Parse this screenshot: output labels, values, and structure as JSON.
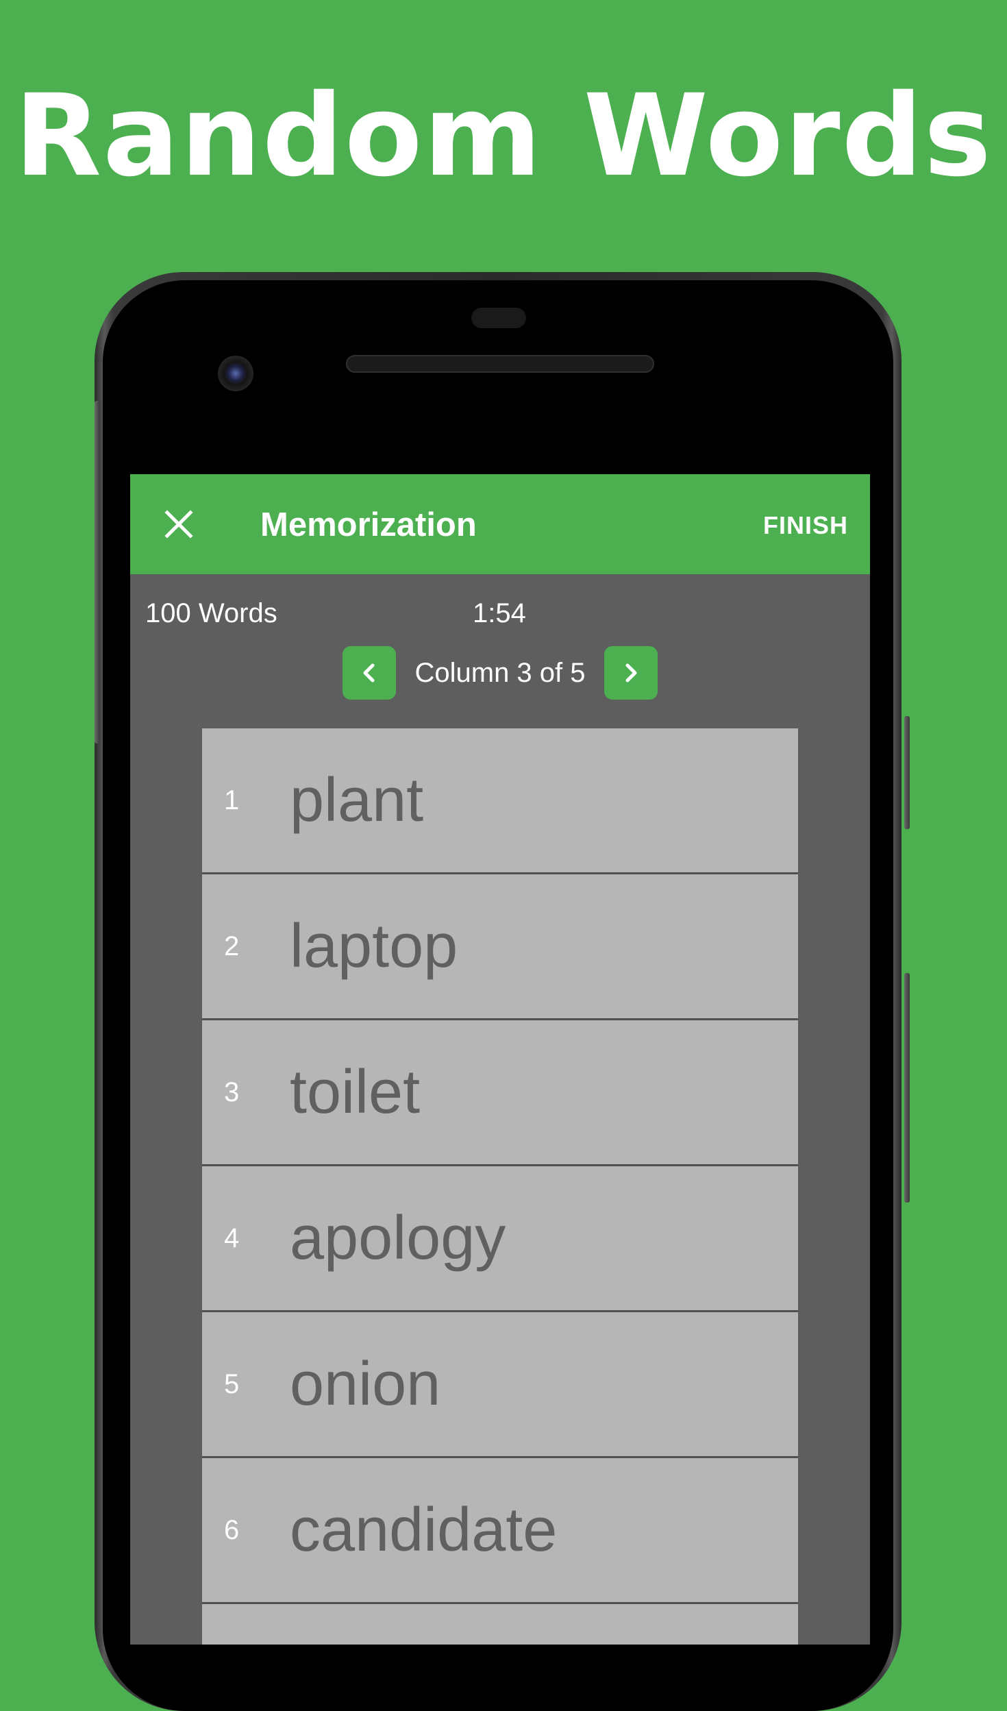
{
  "headline": "Random Words",
  "appbar": {
    "close_icon": "close-icon",
    "title": "Memorization",
    "finish_label": "FINISH"
  },
  "session": {
    "count_label": "100 Words",
    "timer": "1:54"
  },
  "pager": {
    "prev_icon": "chevron-left-icon",
    "label": "Column 3 of 5",
    "next_icon": "chevron-right-icon"
  },
  "words": [
    {
      "num": "1",
      "word": "plant"
    },
    {
      "num": "2",
      "word": "laptop"
    },
    {
      "num": "3",
      "word": "toilet"
    },
    {
      "num": "4",
      "word": "apology"
    },
    {
      "num": "5",
      "word": "onion"
    },
    {
      "num": "6",
      "word": "candidate"
    },
    {
      "num": "",
      "word": ""
    }
  ],
  "colors": {
    "accent": "#4caf50",
    "screen_bg": "#5e5e5e",
    "row_bg": "#b6b6b6",
    "word_text": "#606060"
  }
}
